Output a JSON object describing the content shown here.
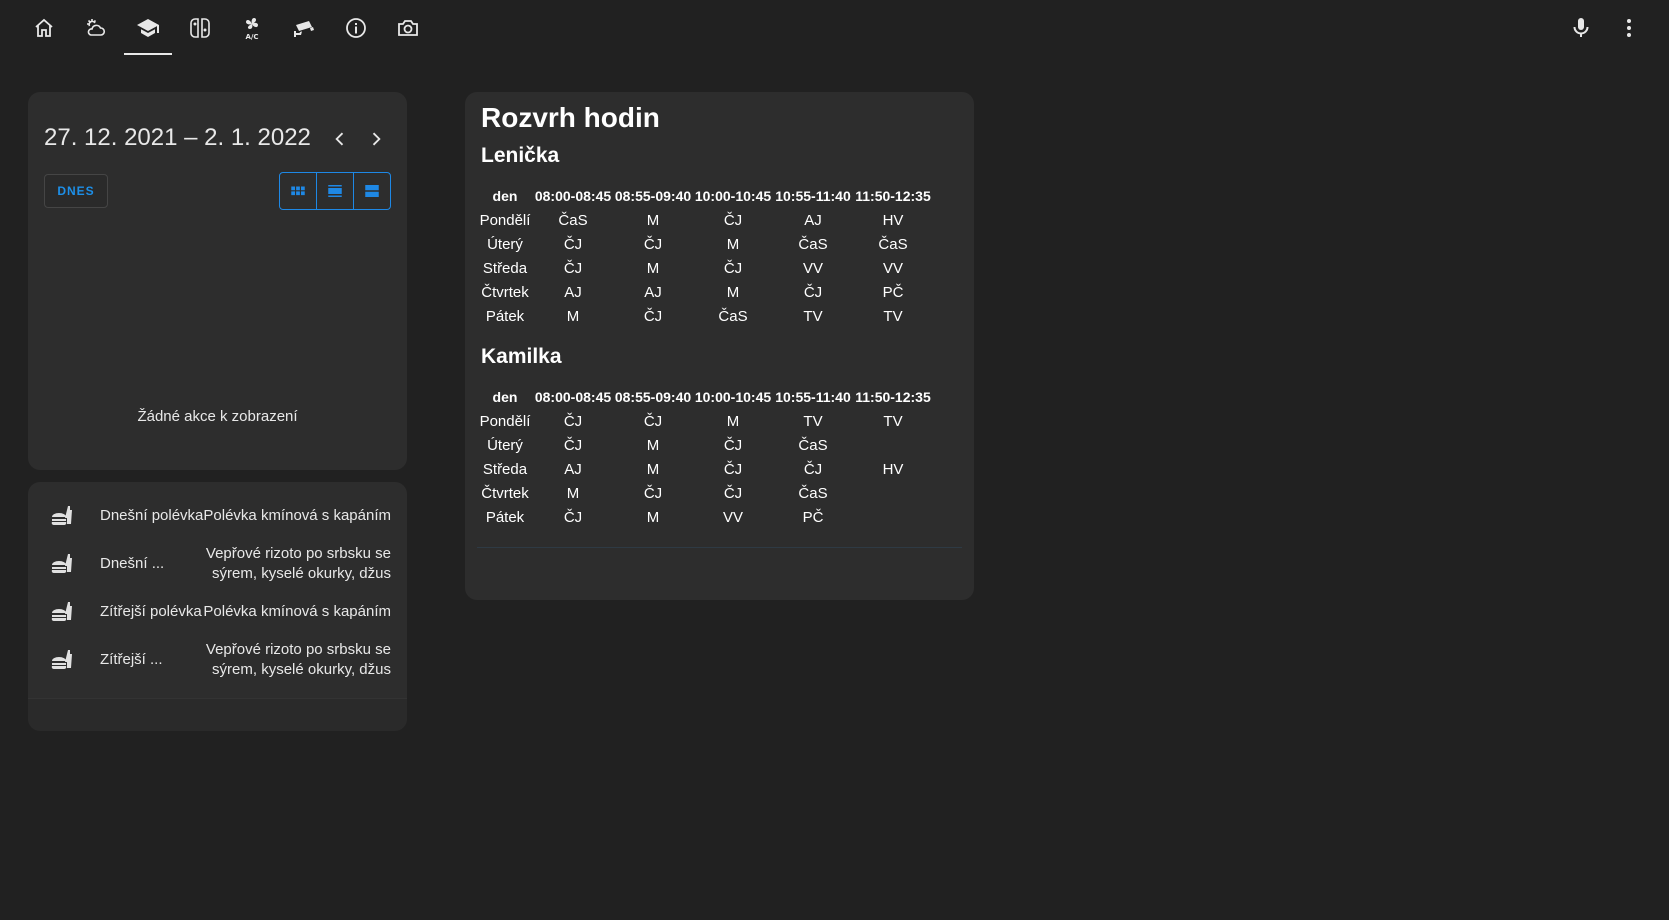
{
  "nav": {
    "tabs": [
      {
        "name": "tab-home",
        "icon": "home-icon"
      },
      {
        "name": "tab-weather",
        "icon": "weather-partly-cloudy-icon"
      },
      {
        "name": "tab-school",
        "icon": "school-icon"
      },
      {
        "name": "tab-nintendo-switch",
        "icon": "nintendo-switch-icon"
      },
      {
        "name": "tab-air-conditioner",
        "icon": "air-conditioner-icon"
      },
      {
        "name": "tab-cctv",
        "icon": "cctv-icon"
      },
      {
        "name": "tab-info",
        "icon": "information-outline-icon"
      },
      {
        "name": "tab-camera",
        "icon": "camera-outline-icon"
      }
    ],
    "active_tab": "tab-school",
    "actions": [
      "microphone-icon",
      "dots-vertical-icon"
    ]
  },
  "calendar": {
    "range": "27. 12. 2021 – 2. 1. 2022",
    "today_label": "DNES",
    "views": [
      "view-month-icon",
      "view-list-icon",
      "view-agenda-icon"
    ],
    "empty_text": "Žádné akce k zobrazení"
  },
  "lunch": {
    "items": [
      {
        "name": "Dnešní polévka",
        "value": "Polévka kmínová s kapáním"
      },
      {
        "name": "Dnešní ...",
        "value": "Vepřové rizoto po srbsku se sýrem, kyselé okurky, džus"
      },
      {
        "name": "Zítřejší polévka",
        "value": "Polévka kmínová s kapáním"
      },
      {
        "name": "Zítřejší ...",
        "value": "Vepřové rizoto po srbsku se sýrem, kyselé okurky, džus"
      }
    ],
    "icon": "food-icon"
  },
  "schedule": {
    "title": "Rozvrh hodin",
    "header": [
      "den",
      "08:00-08:45",
      "08:55-09:40",
      "10:00-10:45",
      "10:55-11:40",
      "11:50-12:35"
    ],
    "people": [
      {
        "name": "Lenička",
        "rows": [
          [
            "Pondělí",
            "ČaS",
            "M",
            "ČJ",
            "AJ",
            "HV"
          ],
          [
            "Úterý",
            "ČJ",
            "ČJ",
            "M",
            "ČaS",
            "ČaS"
          ],
          [
            "Středa",
            "ČJ",
            "M",
            "ČJ",
            "VV",
            "VV"
          ],
          [
            "Čtvrtek",
            "AJ",
            "AJ",
            "M",
            "ČJ",
            "PČ"
          ],
          [
            "Pátek",
            "M",
            "ČJ",
            "ČaS",
            "TV",
            "TV"
          ]
        ]
      },
      {
        "name": "Kamilka",
        "rows": [
          [
            "Pondělí",
            "ČJ",
            "ČJ",
            "M",
            "TV",
            "TV"
          ],
          [
            "Úterý",
            "ČJ",
            "M",
            "ČJ",
            "ČaS",
            ""
          ],
          [
            "Středa",
            "AJ",
            "M",
            "ČJ",
            "ČJ",
            "HV"
          ],
          [
            "Čtvrtek",
            "M",
            "ČJ",
            "ČJ",
            "ČaS",
            ""
          ],
          [
            "Pátek",
            "ČJ",
            "M",
            "VV",
            "PČ",
            ""
          ]
        ]
      }
    ]
  },
  "colors": {
    "background": "#212121",
    "card": "#2d2d2d",
    "accent": "#1e88e5",
    "text": "#e1e1e1"
  }
}
